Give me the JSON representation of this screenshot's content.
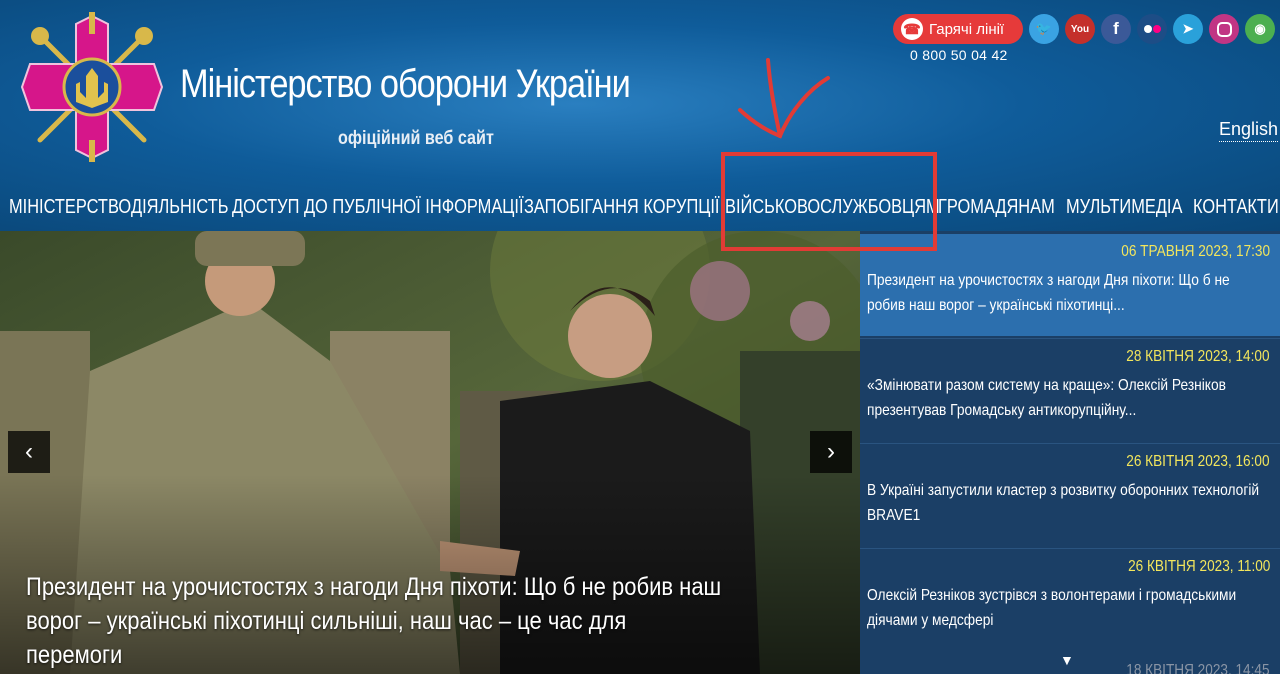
{
  "header": {
    "title": "Міністерство оборони України",
    "subtitle": "офіційний веб сайт",
    "hotline_label": "Гарячі лінії",
    "hotline_phone": "0 800 50 04 42",
    "language_link": "English"
  },
  "social": [
    {
      "name": "twitter",
      "color": "#3aa3e3"
    },
    {
      "name": "youtube",
      "color": "#c4302b"
    },
    {
      "name": "facebook",
      "color": "#3b5998"
    },
    {
      "name": "flickr",
      "color": "#1d4d86"
    },
    {
      "name": "telegram",
      "color": "#2aa1da"
    },
    {
      "name": "instagram",
      "color": "#c13584"
    },
    {
      "name": "accessibility",
      "color": "#4caf50"
    }
  ],
  "nav": [
    "МІНІСТЕРСТВО",
    "ДІЯЛЬНІСТЬ",
    "ДОСТУП ДО ПУБЛІЧНОЇ ІНФОРМАЦІЇ",
    "ЗАПОБІГАННЯ КОРУПЦІЇ",
    "ВІЙСЬКОВОСЛУЖБОВЦЯМ",
    "ГРОМАДЯНАМ",
    "МУЛЬТИМЕДІА",
    "КОНТАКТИ"
  ],
  "hero": {
    "caption": "Президент на урочистостях з нагоди Дня піхоти: Що б не робив наш ворог – українські піхотинці сильніші, наш час – це час для перемоги"
  },
  "news": [
    {
      "date": "06 ТРАВНЯ 2023, 17:30",
      "text": "Президент на урочистостях з нагоди Дня піхоти: Що б не робив наш ворог – українські піхотинці...",
      "active": true
    },
    {
      "date": "28 КВІТНЯ 2023, 14:00",
      "text": "«Змінювати разом систему на краще»: Олексій Резніков презентував Громадську антикорупційну...",
      "active": false
    },
    {
      "date": "26 КВІТНЯ 2023, 16:00",
      "text": "В Україні запустили кластер з розвитку оборонних технологій BRAVE1",
      "active": false
    },
    {
      "date": "26 КВІТНЯ 2023, 11:00",
      "text": "Олексій Резніков зустрівся з волонтерами і громадськими діячами у медсфері",
      "active": false
    }
  ],
  "news_peek_date": "18 КВІТНЯ 2023, 14:45",
  "colors": {
    "active_news": "#2c6fae",
    "news_bg": "#1b3f66",
    "annotation": "#e23b35",
    "date": "#f3e65c"
  }
}
